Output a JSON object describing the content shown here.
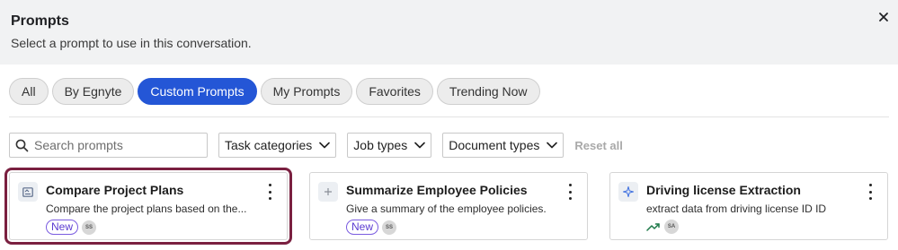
{
  "dialog": {
    "title": "Prompts",
    "subtitle": "Select a prompt to use in this conversation.",
    "close_icon": "close-icon"
  },
  "tabs": [
    {
      "label": "All",
      "active": false
    },
    {
      "label": "By Egnyte",
      "active": false
    },
    {
      "label": "Custom Prompts",
      "active": true
    },
    {
      "label": "My Prompts",
      "active": false
    },
    {
      "label": "Favorites",
      "active": false
    },
    {
      "label": "Trending Now",
      "active": false
    }
  ],
  "filters": {
    "search_placeholder": "Search prompts",
    "task_categories": "Task categories",
    "job_types": "Job types",
    "document_types": "Document types",
    "reset": "Reset all"
  },
  "cards": [
    {
      "title": "Compare Project Plans",
      "description": "Compare the project plans based on the...",
      "badge": "New",
      "avatar": "SS",
      "icon": "document-compare-icon",
      "selected": true
    },
    {
      "title": "Summarize Employee Policies",
      "description": "Give a summary of the employee policies.",
      "badge": "New",
      "avatar": "SS",
      "icon": "plus-icon",
      "selected": false
    },
    {
      "title": "Driving license Extraction",
      "description": "extract data from driving license ID ID",
      "avatar": "SA",
      "icon": "sparkle-icon",
      "trending_icon": "trending-up-icon",
      "selected": false
    }
  ],
  "colors": {
    "accent": "#2456d6",
    "selected_outline": "#7a2040",
    "badge_new": "#5b3bd1",
    "trending": "#1f7a4a"
  }
}
